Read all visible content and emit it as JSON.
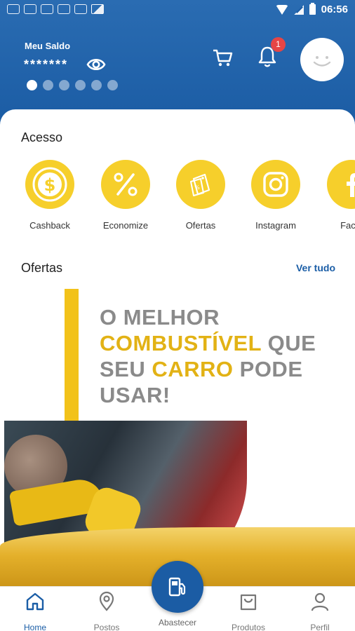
{
  "status_bar": {
    "time": "06:56",
    "icons": [
      "notification-icon",
      "notification-icon",
      "notification-icon",
      "notification-icon",
      "notification-icon",
      "image-icon",
      "wifi-icon",
      "signal-icon",
      "battery-icon"
    ]
  },
  "header": {
    "balance_label": "Meu Saldo",
    "balance_value": "*******",
    "notification_count": "1",
    "carousel_dots": 6,
    "carousel_active_index": 0
  },
  "acesso": {
    "title": "Acesso",
    "items": [
      {
        "label": "Cashback",
        "icon": "dollar-coin-icon"
      },
      {
        "label": "Economize",
        "icon": "percent-icon"
      },
      {
        "label": "Ofertas",
        "icon": "tag-icon"
      },
      {
        "label": "Instagram",
        "icon": "instagram-icon"
      },
      {
        "label": "Facel",
        "icon": "facebook-icon"
      }
    ]
  },
  "ofertas": {
    "title": "Ofertas",
    "view_all": "Ver tudo",
    "banner": {
      "line1": "O MELHOR",
      "line2_highlight": "COMBUSTÍVEL",
      "line2_rest": " QUE",
      "line3_start": "SEU ",
      "line3_highlight": "CARRO",
      "line3_rest": " PODE",
      "line4": "USAR!"
    }
  },
  "bottom_nav": {
    "items": [
      {
        "label": "Home",
        "icon": "home-icon",
        "active": true
      },
      {
        "label": "Postos",
        "icon": "location-pin-icon",
        "active": false
      },
      {
        "label": "Abastecer",
        "icon": "fuel-pump-icon",
        "active": false
      },
      {
        "label": "Produtos",
        "icon": "shopping-bag-icon",
        "active": false
      },
      {
        "label": "Perfil",
        "icon": "person-icon",
        "active": false
      }
    ]
  },
  "colors": {
    "brand_blue": "#1b5ca4",
    "accent_yellow": "#f6cf2b",
    "badge_red": "#e64545"
  }
}
